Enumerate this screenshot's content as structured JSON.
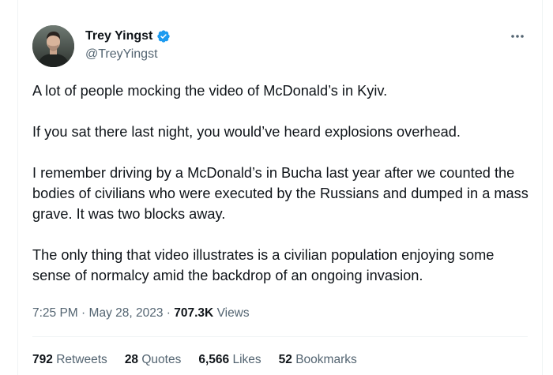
{
  "author": {
    "display_name": "Trey Yingst",
    "handle": "@TreyYingst",
    "verified_color": "#1d9bf0"
  },
  "tweet": {
    "paragraphs": [
      "A lot of people mocking the video of McDonald’s in Kyiv.",
      "If you sat there last night, you would’ve heard explosions overhead.",
      "I remember driving by a McDonald’s in Bucha last year after we counted the bodies of civilians who were executed by the Russians and dumped in a mass grave. It was two blocks away.",
      "The only thing that video illustrates is a civilian population enjoying some sense of normalcy amid the backdrop of an ongoing invasion."
    ]
  },
  "meta": {
    "time": "7:25 PM",
    "separator": "·",
    "date": "May 28, 2023",
    "views_count": "707.3K",
    "views_label": "Views"
  },
  "stats": {
    "retweets_count": "792",
    "retweets_label": "Retweets",
    "quotes_count": "28",
    "quotes_label": "Quotes",
    "likes_count": "6,566",
    "likes_label": "Likes",
    "bookmarks_count": "52",
    "bookmarks_label": "Bookmarks"
  },
  "icons": {
    "more": "more-options-icon",
    "verified": "verified-badge-icon"
  }
}
